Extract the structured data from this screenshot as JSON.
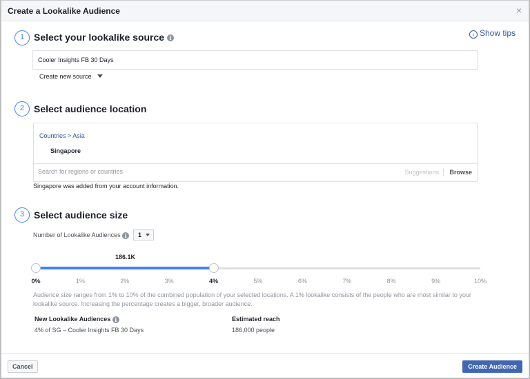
{
  "dialog": {
    "title": "Create a Lookalike Audience",
    "close_glyph": "×"
  },
  "show_tips": {
    "label": "Show tips",
    "glyph": "‹"
  },
  "step1": {
    "number": "1",
    "title": "Select your lookalike source",
    "source_value": "Cooler Insights FB 30 Days",
    "create_new_source": "Create new source"
  },
  "step2": {
    "number": "2",
    "title": "Select audience location",
    "breadcrumb": "Countries > Asia",
    "selected_country": "Singapore",
    "search_placeholder": "Search for regions or countries",
    "suggestions": "Suggestions",
    "browse": "Browse",
    "note": "Singapore was added from your account information."
  },
  "step3": {
    "number": "3",
    "title": "Select audience size",
    "num_label": "Number of Lookalike Audiences",
    "num_value": "1",
    "reach_label": "186.1K",
    "slider": {
      "min": 0,
      "max": 10,
      "selected_start": 0,
      "selected_end": 4,
      "ticks": [
        "0%",
        "1%",
        "2%",
        "3%",
        "4%",
        "5%",
        "6%",
        "7%",
        "8%",
        "9%",
        "10%"
      ]
    },
    "description": "Audience size ranges from 1% to 10% of the combined population of your selected locations. A 1% lookalike consists of the people who are most similar to your lookalike source. Increasing the percentage creates a bigger, broader audience.",
    "new_audiences_header": "New Lookalike Audiences",
    "new_audiences_value": "4% of SG – Cooler Insights FB 30 Days",
    "estimated_reach_header": "Estimated reach",
    "estimated_reach_value": "186,000 people"
  },
  "footer": {
    "cancel": "Cancel",
    "create": "Create Audience"
  },
  "colors": {
    "accent": "#4080ff",
    "primary_button": "#4267b2",
    "link": "#365899"
  }
}
